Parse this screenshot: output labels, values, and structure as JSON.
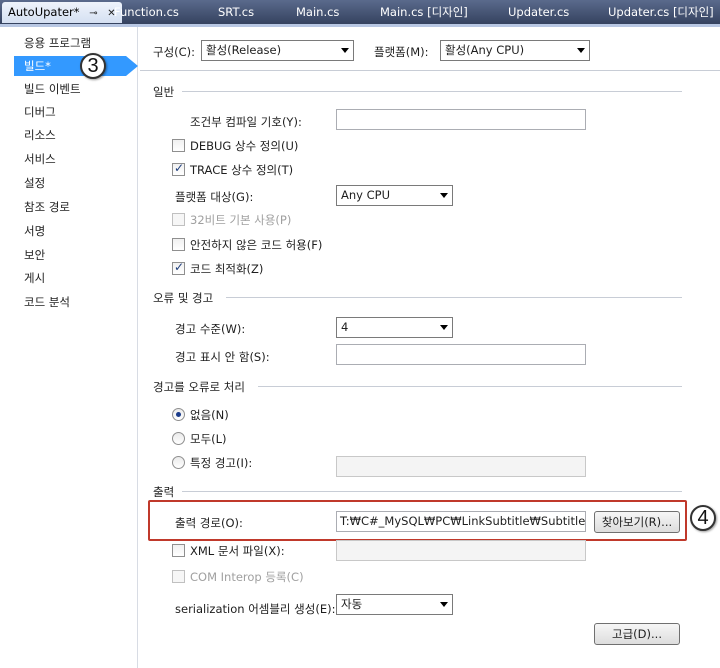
{
  "tabs": [
    {
      "label": "AutoUpater*",
      "active": true,
      "pin": "pin-icon",
      "close": "close-icon"
    },
    {
      "label": "Function.cs"
    },
    {
      "label": "SRT.cs"
    },
    {
      "label": "Main.cs"
    },
    {
      "label": "Main.cs [디자인]"
    },
    {
      "label": "Updater.cs"
    },
    {
      "label": "Updater.cs [디자인]"
    }
  ],
  "sidebar": {
    "items": [
      {
        "label": "응용 프로그램"
      },
      {
        "label": "빌드*",
        "selected": true
      },
      {
        "label": "빌드 이벤트"
      },
      {
        "label": "디버그"
      },
      {
        "label": "리소스"
      },
      {
        "label": "서비스"
      },
      {
        "label": "설정"
      },
      {
        "label": "참조 경로"
      },
      {
        "label": "서명"
      },
      {
        "label": "보안"
      },
      {
        "label": "게시"
      },
      {
        "label": "코드 분석"
      }
    ]
  },
  "callouts": {
    "first": "3",
    "second": "4"
  },
  "header": {
    "config_label": "구성(C):",
    "config_value": "활성(Release)",
    "platform_label": "플랫폼(M):",
    "platform_value": "활성(Any CPU)"
  },
  "general": {
    "title": "일반",
    "conditional_label": "조건부 컴파일 기호(Y):",
    "conditional_value": "",
    "debug_label": "DEBUG 상수 정의(U)",
    "debug_checked": false,
    "trace_label": "TRACE 상수 정의(T)",
    "trace_checked": true,
    "platform_target_label": "플랫폼 대상(G):",
    "platform_target_value": "Any CPU",
    "prefer32_label": "32비트 기본 사용(P)",
    "prefer32_checked": false,
    "unsafe_label": "안전하지 않은 코드 허용(F)",
    "unsafe_checked": false,
    "optimize_label": "코드 최적화(Z)",
    "optimize_checked": true
  },
  "errors": {
    "title": "오류 및 경고",
    "level_label": "경고 수준(W):",
    "level_value": "4",
    "suppress_label": "경고 표시 안 함(S):",
    "suppress_value": ""
  },
  "treat_warnings": {
    "title": "경고를 오류로 처리",
    "none_label": "없음(N)",
    "all_label": "모두(L)",
    "specific_label": "특정 경고(I):",
    "selected": "none",
    "specific_value": ""
  },
  "output": {
    "title": "출력",
    "path_label": "출력 경로(O):",
    "path_value": "T:₩C#_MySQL₩PC₩LinkSubtitle₩SubtitleManag",
    "browse_label": "찾아보기(R)...",
    "xml_label": "XML 문서 파일(X):",
    "xml_checked": false,
    "xml_value": "",
    "com_label": "COM Interop 등록(C)",
    "com_checked": false,
    "serialization_label": "serialization 어셈블리 생성(E):",
    "serialization_value": "자동",
    "advanced_label": "고급(D)..."
  },
  "colors": {
    "selected_nav": "#3399ff",
    "highlight_box": "#c0392b",
    "tabstrip": "#35425f"
  }
}
